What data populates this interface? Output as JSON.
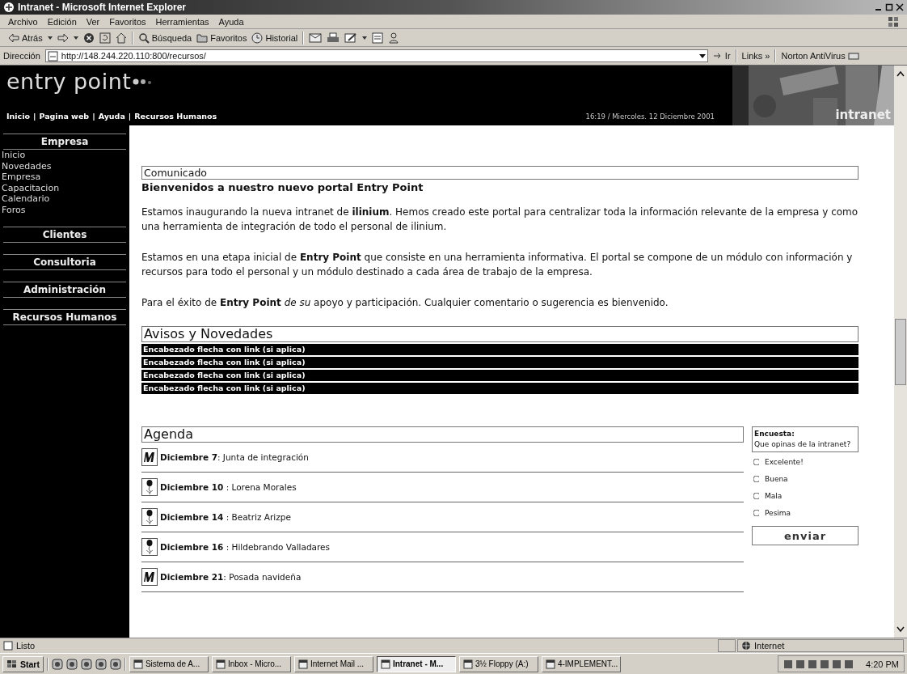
{
  "window": {
    "title": "Intranet - Microsoft Internet Explorer"
  },
  "menu": [
    "Archivo",
    "Edición",
    "Ver",
    "Favoritos",
    "Herramientas",
    "Ayuda"
  ],
  "toolbar": {
    "back": "Atrás",
    "search": "Búsqueda",
    "favorites": "Favoritos",
    "history": "Historial"
  },
  "address": {
    "label": "Dirección",
    "value": "http://148.244.220.110:800/recursos/",
    "go": "Ir",
    "links": "Links »",
    "norton": "Norton AntiVirus"
  },
  "header": {
    "logo": "entry point",
    "nav": [
      "Inicio",
      "Pagina web",
      "Ayuda",
      "Recursos Humanos"
    ],
    "separator": "|",
    "date": "16:19 / Miercoles. 12 Diciembre 2001",
    "brand": "intranet"
  },
  "sidebar": {
    "sections": [
      {
        "title": "Empresa",
        "items": [
          "Inicio",
          "Novedades",
          "Empresa",
          "Capacitacion",
          "Calendario",
          "Foros"
        ]
      },
      {
        "title": "Clientes"
      },
      {
        "title": "Consultoria"
      },
      {
        "title": "Administración"
      },
      {
        "title": "Recursos Humanos"
      }
    ]
  },
  "comunicado": {
    "heading": "Comunicado",
    "title": "Bienvenidos a nuestro nuevo portal Entry Point",
    "paragraphs": [
      "Estamos inaugurando la nueva intranet de **ilinium**. Hemos creado este portal para centralizar toda la información relevante de la empresa y como una herramienta de integración de todo el personal de ilinium.",
      "Estamos en una etapa inicial de **Entry Point** que consiste en una herramienta informativa. El portal se compone de un módulo con información y recursos para todo el personal y un módulo destinado a cada área de trabajo de la empresa.",
      "Para el éxito de **Entry Point** *de su* apoyo y participación. Cualquier comentario o sugerencia es bienvenido."
    ]
  },
  "avisos": {
    "heading": "Avisos y Novedades",
    "items": [
      "Encabezado  flecha con link (si aplica)",
      "Encabezado  flecha con link (si aplica)",
      "Encabezado  flecha con link (si aplica)",
      "Encabezado  flecha con link (si aplica)"
    ]
  },
  "agenda": {
    "heading": "Agenda",
    "items": [
      {
        "kind": "meeting",
        "text": "**Diciembre 7**: Junta de integración"
      },
      {
        "kind": "birthday",
        "text": "**Diciembre 10** : Lorena Morales"
      },
      {
        "kind": "birthday",
        "text": "**Diciembre 14** : Beatriz Arizpe"
      },
      {
        "kind": "birthday",
        "text": "**Diciembre 16** : Hildebrando Valladares"
      },
      {
        "kind": "meeting",
        "text": "**Diciembre 21**: Posada navideña"
      }
    ]
  },
  "poll": {
    "title": "Encuesta:",
    "question": "Que opinas de la intranet?",
    "options": [
      {
        "label": "Excelente!",
        "selected": false
      },
      {
        "label": "Buena",
        "selected": false
      },
      {
        "label": "Mala",
        "selected": false
      },
      {
        "label": "Pesima",
        "selected": false
      }
    ],
    "submit": "enviar"
  },
  "status_bar": {
    "text": "Listo",
    "zone": "Internet"
  },
  "taskbar": {
    "start": "Start",
    "tasks": [
      {
        "label": "Sistema de A...",
        "selected": false
      },
      {
        "label": "Inbox - Micro...",
        "selected": false
      },
      {
        "label": "Internet Mail ...",
        "selected": false
      },
      {
        "label": "Intranet - M...",
        "selected": true
      },
      {
        "label": "3½ Floppy (A:)",
        "selected": false
      },
      {
        "label": "4-IMPLEMENT...",
        "selected": false
      }
    ],
    "clock": "4:20 PM"
  }
}
